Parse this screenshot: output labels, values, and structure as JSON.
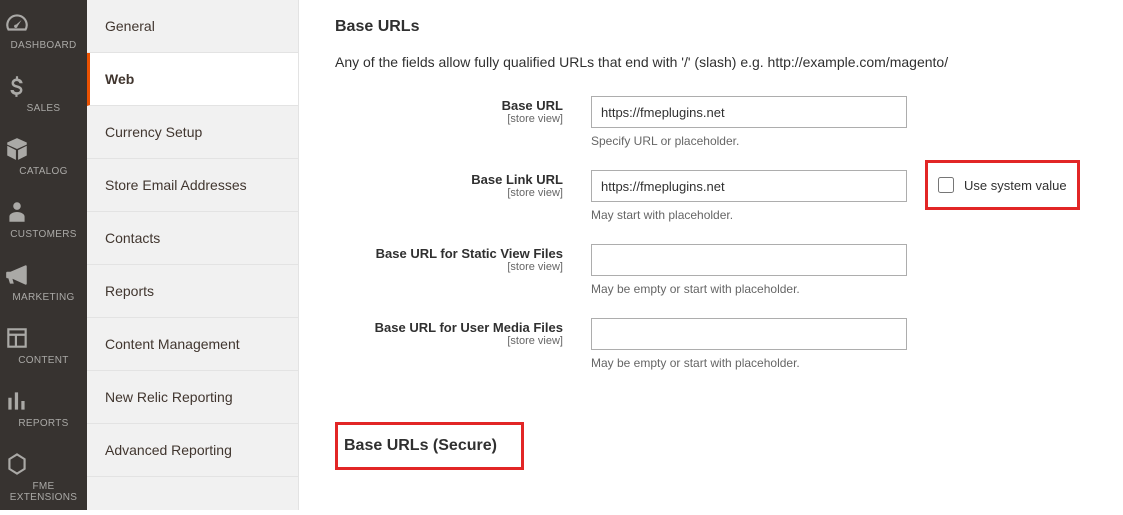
{
  "adminNav": [
    {
      "id": "dashboard",
      "label": "DASHBOARD"
    },
    {
      "id": "sales",
      "label": "SALES"
    },
    {
      "id": "catalog",
      "label": "CATALOG"
    },
    {
      "id": "customers",
      "label": "CUSTOMERS"
    },
    {
      "id": "marketing",
      "label": "MARKETING"
    },
    {
      "id": "content",
      "label": "CONTENT"
    },
    {
      "id": "reports",
      "label": "REPORTS"
    },
    {
      "id": "fme",
      "label": "FME EXTENSIONS"
    }
  ],
  "tabs": [
    {
      "label": "General",
      "active": false
    },
    {
      "label": "Web",
      "active": true
    },
    {
      "label": "Currency Setup",
      "active": false
    },
    {
      "label": "Store Email Addresses",
      "active": false
    },
    {
      "label": "Contacts",
      "active": false
    },
    {
      "label": "Reports",
      "active": false
    },
    {
      "label": "Content Management",
      "active": false
    },
    {
      "label": "New Relic Reporting",
      "active": false
    },
    {
      "label": "Advanced Reporting",
      "active": false
    }
  ],
  "section": {
    "title": "Base URLs",
    "note": "Any of the fields allow fully qualified URLs that end with '/' (slash) e.g. http://example.com/magento/",
    "secureTitle": "Base URLs (Secure)"
  },
  "scopeLabel": "[store view]",
  "useSystemLabel": "Use system value",
  "fields": {
    "baseUrl": {
      "label": "Base URL",
      "value": "https://fmeplugins.net",
      "hint": "Specify URL or placeholder."
    },
    "baseLinkUrl": {
      "label": "Base Link URL",
      "value": "https://fmeplugins.net",
      "hint": "May start with placeholder."
    },
    "baseStatic": {
      "label": "Base URL for Static View Files",
      "value": "",
      "hint": "May be empty or start with placeholder."
    },
    "baseMedia": {
      "label": "Base URL for User Media Files",
      "value": "",
      "hint": "May be empty or start with placeholder."
    }
  }
}
